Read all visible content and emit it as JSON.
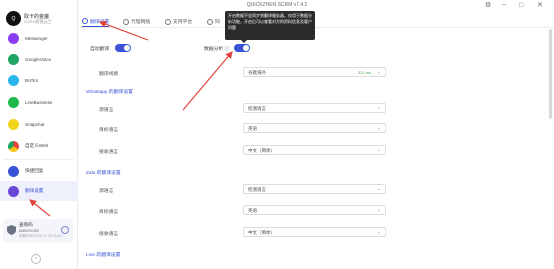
{
  "window": {
    "title": "QUICKZHEN SCRM v7.4.2",
    "controls": [
      "⚙",
      "−",
      "□",
      "✕"
    ]
  },
  "sidebar": {
    "profile": {
      "avatar": "Q",
      "name": "取卡的金魔",
      "sub": "SCRM智能云工"
    },
    "apps": [
      {
        "label": "Messenger",
        "icon": "messenger-icon",
        "color": "#8a3df0"
      },
      {
        "label": "GoogleVoice",
        "icon": "google-voice-icon",
        "color": "#1fa463"
      },
      {
        "label": "BoTim",
        "icon": "botim-icon",
        "color": "#29b6e8"
      },
      {
        "label": "LineBusiness",
        "icon": "line-icon",
        "color": "#1eb94b"
      },
      {
        "label": "Snapchat",
        "icon": "snapchat-icon",
        "color": "#f2d51a"
      },
      {
        "label": "自定义Web",
        "icon": "chrome-icon",
        "color": "#e8453c"
      }
    ],
    "bottom_items": [
      {
        "label": "快捷回复",
        "icon": "quick-reply-icon",
        "color": "#3a54d6"
      },
      {
        "label": "翻译设置",
        "icon": "translate-settings-icon",
        "color": "#6a45d8"
      }
    ],
    "account": {
      "name": "查询码",
      "id": "#NMOCN9",
      "expiry": "到期时间 2025-01-15 00:00"
    },
    "collapse": "‹"
  },
  "tabs": [
    {
      "label": "翻译设置",
      "icon": "translate-icon"
    },
    {
      "label": "代理网络",
      "icon": "globe-icon"
    },
    {
      "label": "支持平台",
      "icon": "platform-icon"
    },
    {
      "label": "同",
      "icon": "sync-icon"
    }
  ],
  "tooltip": "开启数据不会同步到翻译服务器，仅用于数据分析功能，开启后可以查看对方的资料信息及客户问题",
  "settings": {
    "auto_translate_label": "自动翻译",
    "data_analysis_label": "数据分析 ⓘ",
    "translate_route_label": "翻译线路",
    "translate_route_value": "谷歌海外",
    "translate_route_latency": "321 ms"
  },
  "sections": [
    {
      "title": "Whatsapp 的翻译设置",
      "rows": [
        {
          "label": "源语言",
          "value": "检测语言"
        },
        {
          "label": "目标语言",
          "value": "英语"
        },
        {
          "label": "接收语言",
          "value": "中文（简体）"
        }
      ]
    },
    {
      "title": "Zalo 的翻译设置",
      "rows": [
        {
          "label": "源语言",
          "value": "检测语言"
        },
        {
          "label": "目标语言",
          "value": "英语"
        },
        {
          "label": "接收语言",
          "value": "中文（简体）"
        }
      ]
    },
    {
      "title": "Line 的翻译设置",
      "rows": []
    }
  ],
  "colors": {
    "accent": "#3a54d6",
    "annotation": "#e0443c"
  }
}
